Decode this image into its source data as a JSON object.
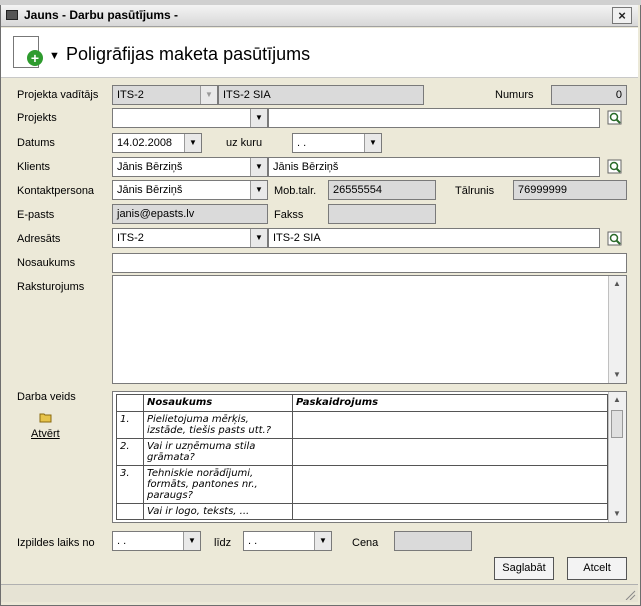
{
  "window": {
    "title": "Jauns - Darbu pasūtījums -",
    "close_symbol": "×"
  },
  "header": {
    "title": "Poligrāfijas maketa pasūtījums",
    "icon": "add-document-icon",
    "menu_arrow": "▼"
  },
  "form": {
    "projekta_vaditajs": {
      "label": "Projekta vadītājs",
      "code": "ITS-2",
      "name": "ITS-2 SIA"
    },
    "numurs": {
      "label": "Numurs",
      "value": "0"
    },
    "projekts": {
      "label": "Projekts",
      "code": "",
      "name": ""
    },
    "datums": {
      "label": "Datums",
      "value": "14.02.2008",
      "uz_kuru_label": "uz kuru",
      "uz_kuru_value": " .  ."
    },
    "klients": {
      "label": "Klients",
      "value": "Jānis Bērziņš",
      "name": "Jānis Bērziņš"
    },
    "kontaktpersona": {
      "label": "Kontaktpersona",
      "value": "Jānis Bērziņš"
    },
    "mob_talr": {
      "label": "Mob.talr.",
      "value": "26555554"
    },
    "talrunis": {
      "label": "Tālrunis",
      "value": "76999999"
    },
    "epasts": {
      "label": "E-pasts",
      "value": "janis@epasts.lv"
    },
    "fakss": {
      "label": "Fakss",
      "value": ""
    },
    "adresats": {
      "label": "Adresāts",
      "code": "ITS-2",
      "name": "ITS-2 SIA"
    },
    "nosaukums": {
      "label": "Nosaukums",
      "value": ""
    },
    "raksturojums": {
      "label": "Raksturojums",
      "value": ""
    },
    "darba_veids": {
      "label": "Darba veids",
      "open_label": "Atvērt"
    },
    "izpildes": {
      "label": "Izpildes laiks no",
      "from": " .  .",
      "lidz_label": "līdz",
      "to": " .  .",
      "cena_label": "Cena",
      "cena_value": ""
    }
  },
  "grid": {
    "headers": [
      "",
      "Nosaukums",
      "Paskaidrojums"
    ],
    "rows": [
      {
        "num": "1.",
        "nosaukums": "Pielietojuma mērķis, izstāde, tiešis pasts utt.?",
        "paskaidrojums": ""
      },
      {
        "num": "2.",
        "nosaukums": "Vai ir uzņēmuma stila grāmata?",
        "paskaidrojums": ""
      },
      {
        "num": "3.",
        "nosaukums": "Tehniskie norādījumi, formāts, pantones nr., paraugs?",
        "paskaidrojums": ""
      },
      {
        "num": "",
        "nosaukums": "Vai ir logo, teksts, ...",
        "paskaidrojums": ""
      }
    ]
  },
  "buttons": {
    "save": "Saglabāt",
    "cancel": "Atcelt"
  },
  "colors": {
    "readonly_bg": "#dadada",
    "window_bg": "#ece9d8"
  }
}
